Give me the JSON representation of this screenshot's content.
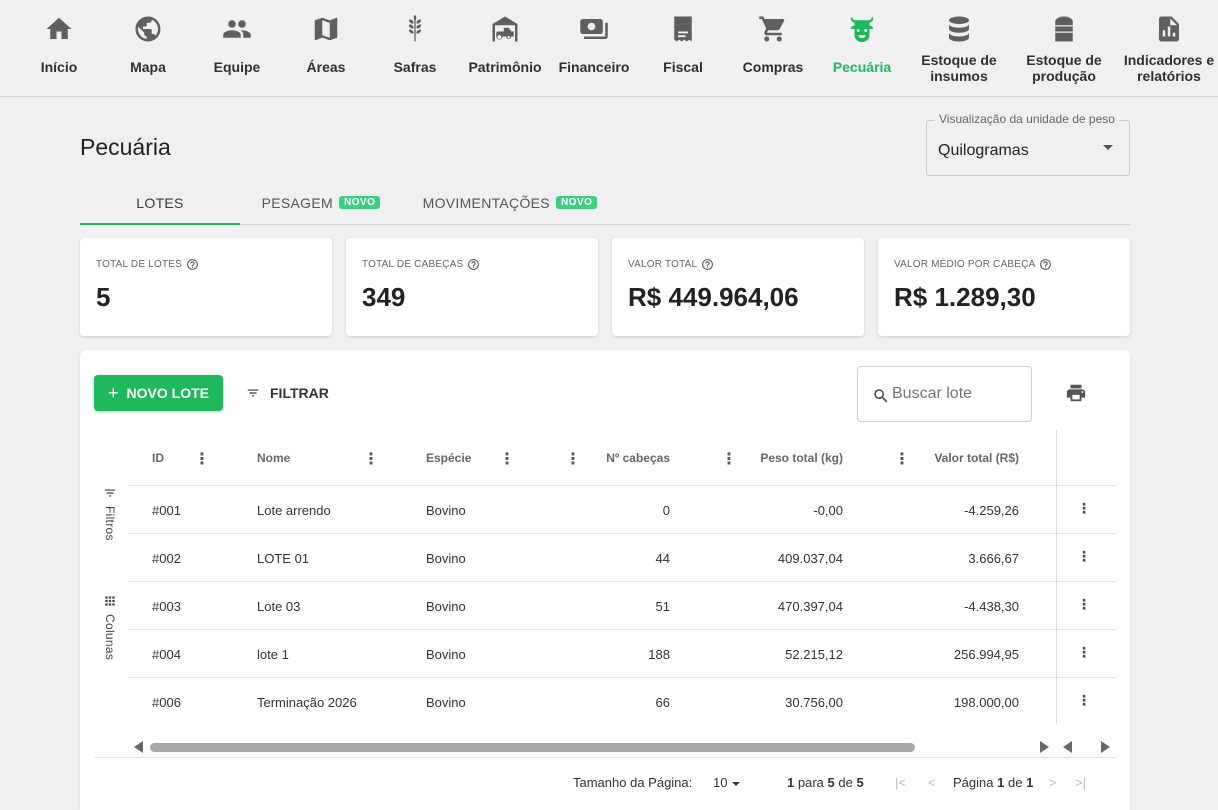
{
  "nav": [
    {
      "label": "Início",
      "icon": "home-icon"
    },
    {
      "label": "Mapa",
      "icon": "globe-icon"
    },
    {
      "label": "Equipe",
      "icon": "people-icon"
    },
    {
      "label": "Áreas",
      "icon": "map-icon"
    },
    {
      "label": "Safras",
      "icon": "wheat-icon"
    },
    {
      "label": "Patrimônio",
      "icon": "tractor-barn-icon"
    },
    {
      "label": "Financeiro",
      "icon": "money-icon"
    },
    {
      "label": "Fiscal",
      "icon": "receipt-icon"
    },
    {
      "label": "Compras",
      "icon": "cart-icon"
    },
    {
      "label": "Pecuária",
      "icon": "cow-icon",
      "active": true
    },
    {
      "label": "Estoque de insumos",
      "icon": "database-icon"
    },
    {
      "label": "Estoque de produção",
      "icon": "silo-icon"
    },
    {
      "label": "Indicadores e relatórios",
      "icon": "report-icon"
    }
  ],
  "page": {
    "title": "Pecuária",
    "weight_unit": {
      "legend": "Visualização da unidade de peso",
      "value": "Quilogramas"
    }
  },
  "tabs": [
    {
      "label": "LOTES",
      "active": true
    },
    {
      "label": "PESAGEM",
      "badge": "NOVO"
    },
    {
      "label": "MOVIMENTAÇÕES",
      "badge": "NOVO"
    }
  ],
  "summary": [
    {
      "label": "TOTAL DE LOTES",
      "value": "5"
    },
    {
      "label": "TOTAL DE CABEÇAS",
      "value": "349"
    },
    {
      "label": "VALOR TOTAL",
      "value": "R$ 449.964,06"
    },
    {
      "label": "VALOR MÉDIO POR CABEÇA",
      "value": "R$ 1.289,30"
    }
  ],
  "toolbar": {
    "new_label": "NOVO LOTE",
    "filter_label": "FILTRAR",
    "search_placeholder": "Buscar lote"
  },
  "side": {
    "filters": "Filtros",
    "columns": "Colunas"
  },
  "table": {
    "columns": [
      "ID",
      "Nome",
      "Espécie",
      "",
      "Nº cabeças",
      "Peso total (kg)",
      "Valor total (R$)"
    ],
    "rows": [
      {
        "id": "#001",
        "nome": "Lote arrendo",
        "especie": "Bovino",
        "cabecas": "0",
        "peso": "-0,00",
        "valor": "-4.259,26"
      },
      {
        "id": "#002",
        "nome": "LOTE 01",
        "especie": "Bovino",
        "cabecas": "44",
        "peso": "409.037,04",
        "valor": "3.666,67"
      },
      {
        "id": "#003",
        "nome": "Lote 03",
        "especie": "Bovino",
        "cabecas": "51",
        "peso": "470.397,04",
        "valor": "-4.438,30"
      },
      {
        "id": "#004",
        "nome": "lote 1",
        "especie": "Bovino",
        "cabecas": "188",
        "peso": "52.215,12",
        "valor": "256.994,95"
      },
      {
        "id": "#006",
        "nome": "Terminação 2026",
        "especie": "Bovino",
        "cabecas": "66",
        "peso": "30.756,00",
        "valor": "198.000,00"
      }
    ]
  },
  "footer": {
    "page_size_label": "Tamanho da Página:",
    "page_size": "10",
    "range_from": "1",
    "range_mid": "para",
    "range_to": "5",
    "range_of": "de",
    "range_total": "5",
    "page_label": "Página",
    "page_current": "1",
    "page_of": "de",
    "page_total": "1"
  },
  "colors": {
    "accent": "#1fb85c",
    "badge": "#3ccf80"
  }
}
